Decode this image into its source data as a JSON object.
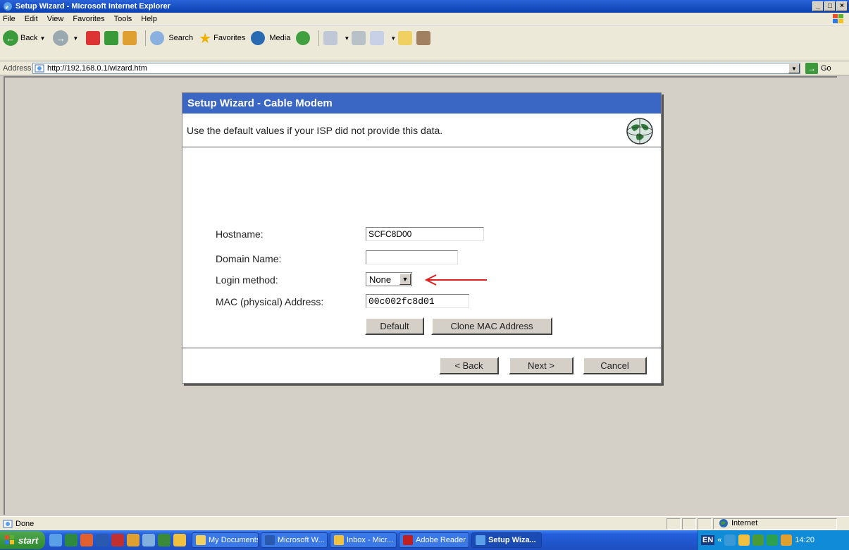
{
  "window": {
    "title": "Setup Wizard - Microsoft Internet Explorer",
    "controls": [
      "_",
      "□",
      "×"
    ]
  },
  "menu": [
    "File",
    "Edit",
    "View",
    "Favorites",
    "Tools",
    "Help"
  ],
  "toolbar": {
    "back_label": "Back",
    "search_label": "Search",
    "favorites_label": "Favorites",
    "media_label": "Media"
  },
  "address": {
    "label": "Address",
    "url": "http://192.168.0.1/wizard.htm",
    "go_label": "Go"
  },
  "wizard": {
    "title": "Setup Wizard - Cable Modem",
    "subtitle": "Use the default values if your ISP did not provide this data.",
    "fields": {
      "hostname_label": "Hostname:",
      "hostname_value": "SCFC8D00",
      "domain_label": "Domain Name:",
      "domain_value": "",
      "login_label": "Login method:",
      "login_value": "None",
      "mac_label": "MAC (physical) Address:",
      "mac_value": "00c002fc8d01"
    },
    "buttons": {
      "default": "Default",
      "clone_mac": "Clone MAC Address",
      "back": "< Back",
      "next": "Next >",
      "cancel": "Cancel"
    },
    "annotation_color": "#e02020"
  },
  "status": {
    "text": "Done",
    "zone": "Internet"
  },
  "taskbar": {
    "start_label": "start",
    "tasks": [
      "My Documents",
      "Microsoft W...",
      "Inbox - Micr...",
      "Adobe Reader",
      "Setup Wiza..."
    ],
    "active_task": "Setup Wiza...",
    "language": "EN",
    "clock": "14:20"
  }
}
